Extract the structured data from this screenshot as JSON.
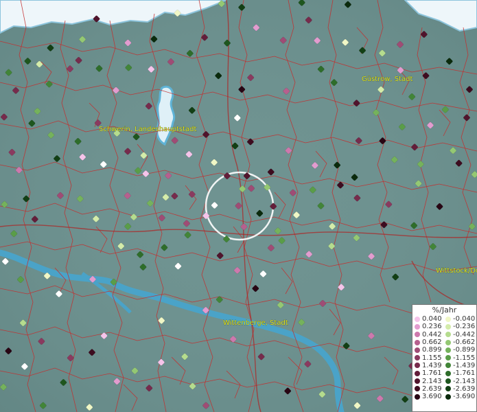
{
  "map": {
    "cities": [
      {
        "name": "Güstrow, Stadt"
      },
      {
        "name": "Schwerin, Landeshauptstadt"
      },
      {
        "name": "Wittstock/Do"
      },
      {
        "name": "Wittenberge, Stadt"
      }
    ],
    "colors": {
      "land": "#6f9391",
      "water": "#4aa3c8",
      "sea": "#eef6fa",
      "borders": "#c42d2d",
      "selection_ring": "#ffffff"
    }
  },
  "legend": {
    "title": "%/Jahr",
    "positive": [
      {
        "label": "0.040",
        "color": "#f5c4ea"
      },
      {
        "label": "0.236",
        "color": "#e29ccf"
      },
      {
        "label": "0.442",
        "color": "#cd79ad"
      },
      {
        "label": "0.662",
        "color": "#b6608e"
      },
      {
        "label": "0.899",
        "color": "#9f4c75"
      },
      {
        "label": "1.155",
        "color": "#8a3a5f"
      },
      {
        "label": "1.439",
        "color": "#762b4c"
      },
      {
        "label": "1.761",
        "color": "#631e3a"
      },
      {
        "label": "2.143",
        "color": "#50142c"
      },
      {
        "label": "2.639",
        "color": "#3d0c1f"
      },
      {
        "label": "3.690",
        "color": "#280513"
      }
    ],
    "negative": [
      {
        "label": "-0.040",
        "color": "#f0f7c6"
      },
      {
        "label": "-0.236",
        "color": "#d4ecaa"
      },
      {
        "label": "-0.442",
        "color": "#b5dc8e"
      },
      {
        "label": "-0.662",
        "color": "#94c873"
      },
      {
        "label": "-0.899",
        "color": "#75b25c"
      },
      {
        "label": "-1.155",
        "color": "#5a9d48"
      },
      {
        "label": "-1.439",
        "color": "#428538"
      },
      {
        "label": "-1.761",
        "color": "#2e6d2a"
      },
      {
        "label": "-2.143",
        "color": "#1e561e"
      },
      {
        "label": "-2.639",
        "color": "#123f14"
      },
      {
        "label": "-3.690",
        "color": "#0a2a0c"
      }
    ]
  }
}
